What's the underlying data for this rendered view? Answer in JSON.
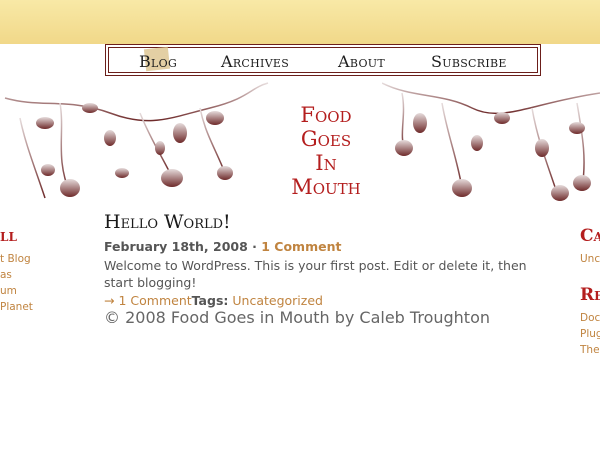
{
  "nav": {
    "items": [
      {
        "label": "Blog"
      },
      {
        "label": "Archives"
      },
      {
        "label": "About"
      },
      {
        "label": "Subscribe"
      }
    ]
  },
  "site": {
    "title_lines": [
      "Food",
      "Goes",
      "In",
      "Mouth"
    ]
  },
  "post": {
    "title": "Hello World!",
    "date": "February 18th, 2008",
    "separator": "·",
    "comments": "1 Comment",
    "content": "Welcome to WordPress. This is your first post. Edit or delete it, then start blogging!",
    "footer_arrow": "→",
    "footer_comment": "1 Comment",
    "tags_label": "Tags:",
    "tags_value": "Uncategorized"
  },
  "footer": {
    "copyright": "© 2008 Food Goes in Mouth by Caleb Troughton"
  },
  "sidebar_left": {
    "heading": "ll",
    "items": [
      "t Blog",
      "as",
      "um",
      "Planet"
    ]
  },
  "sidebar_right": {
    "heading1": "Ca",
    "list1": [
      "Unc"
    ],
    "heading2": "Re",
    "list2": [
      "Doc",
      "Plug",
      "The"
    ]
  },
  "colors": {
    "accent_red": "#b41e1e",
    "link_gold": "#c08440",
    "top_band": "#f4e29a",
    "border": "#6b1e1a"
  },
  "icons": [
    "berry-branch-illustration-left",
    "berry-branch-illustration-right",
    "arrow-right-icon"
  ]
}
